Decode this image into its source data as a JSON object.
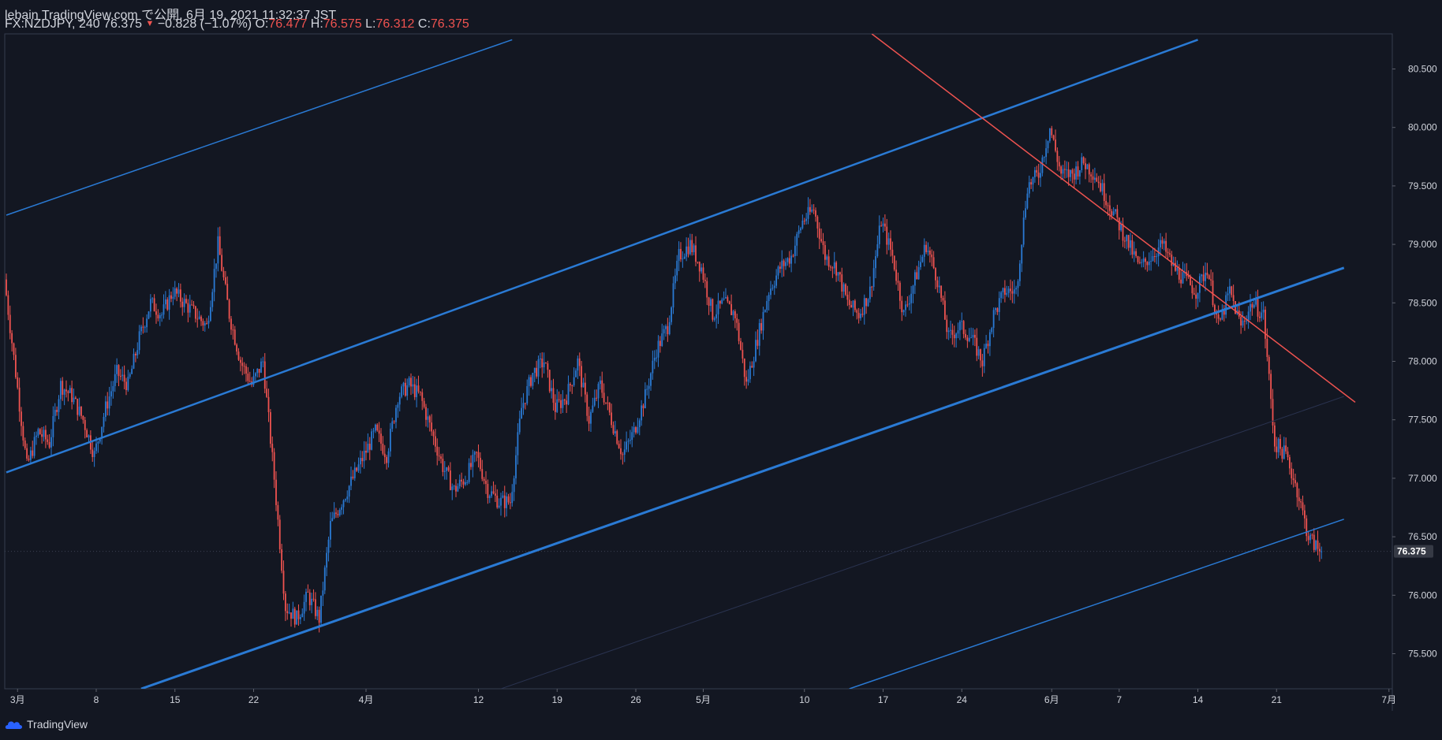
{
  "header": {
    "line1": "lebain TradingView.com で公開, 6月 19, 2021 11:32:37 JST",
    "symbol": "FX:NZDJPY, 240",
    "last": "76.375",
    "change": "−0.828 (−1.07%)",
    "o_label": "O:",
    "o_value": "76.477",
    "h_label": "H:",
    "h_value": "76.575",
    "l_label": "L:",
    "l_value": "76.312",
    "c_label": "C:",
    "c_value": "76.375"
  },
  "footer": {
    "brand": "TradingView"
  },
  "colors": {
    "background": "#131722",
    "up": "#2a7ad4",
    "down": "#ef5350",
    "channel": "#2a7ad4",
    "trendline": "#ef5350",
    "axis_text": "#d1d4dc"
  },
  "chart_data": {
    "type": "candlestick",
    "symbol": "FX:NZDJPY",
    "interval": "240",
    "ylim": [
      75.2,
      80.8
    ],
    "y_ticks": [
      "80.500",
      "80.000",
      "79.500",
      "79.000",
      "78.500",
      "78.000",
      "77.500",
      "77.000",
      "76.500",
      "76.000",
      "75.500"
    ],
    "y_tick_values": [
      80.5,
      80.0,
      79.5,
      79.0,
      78.5,
      78.0,
      77.5,
      77.0,
      76.5,
      76.0,
      75.5
    ],
    "last_price_label": "76.375",
    "last_price": 76.375,
    "xlim": [
      0,
      120
    ],
    "x_ticks": [
      {
        "label": "3月",
        "d": 1
      },
      {
        "label": "8",
        "d": 8
      },
      {
        "label": "15",
        "d": 15
      },
      {
        "label": "22",
        "d": 22
      },
      {
        "label": "4月",
        "d": 32
      },
      {
        "label": "12",
        "d": 42
      },
      {
        "label": "19",
        "d": 49
      },
      {
        "label": "26",
        "d": 56
      },
      {
        "label": "5月",
        "d": 62
      },
      {
        "label": "10",
        "d": 71
      },
      {
        "label": "17",
        "d": 78
      },
      {
        "label": "24",
        "d": 85
      },
      {
        "label": "6月",
        "d": 93
      },
      {
        "label": "7",
        "d": 99
      },
      {
        "label": "14",
        "d": 106
      },
      {
        "label": "21",
        "d": 113
      },
      {
        "label": "7月",
        "d": 123
      }
    ],
    "price_path": [
      [
        0,
        78.7
      ],
      [
        1,
        77.9
      ],
      [
        2,
        77.1
      ],
      [
        3,
        77.4
      ],
      [
        4,
        77.3
      ],
      [
        5,
        77.8
      ],
      [
        6,
        77.7
      ],
      [
        7,
        77.5
      ],
      [
        8,
        77.2
      ],
      [
        9,
        77.6
      ],
      [
        10,
        77.9
      ],
      [
        11,
        77.8
      ],
      [
        12,
        78.2
      ],
      [
        13,
        78.5
      ],
      [
        14,
        78.4
      ],
      [
        15,
        78.6
      ],
      [
        16,
        78.5
      ],
      [
        17,
        78.4
      ],
      [
        18,
        78.3
      ],
      [
        19,
        79.0
      ],
      [
        20,
        78.4
      ],
      [
        21,
        78.0
      ],
      [
        22,
        77.8
      ],
      [
        23,
        78.0
      ],
      [
        24,
        77.0
      ],
      [
        25,
        75.9
      ],
      [
        26,
        75.8
      ],
      [
        27,
        76.0
      ],
      [
        28,
        75.8
      ],
      [
        29,
        76.6
      ],
      [
        30,
        76.8
      ],
      [
        31,
        77.0
      ],
      [
        32,
        77.2
      ],
      [
        33,
        77.4
      ],
      [
        34,
        77.2
      ],
      [
        35,
        77.7
      ],
      [
        36,
        77.8
      ],
      [
        37,
        77.7
      ],
      [
        38,
        77.4
      ],
      [
        39,
        77.1
      ],
      [
        40,
        76.9
      ],
      [
        41,
        77.0
      ],
      [
        42,
        77.2
      ],
      [
        43,
        76.9
      ],
      [
        44,
        76.8
      ],
      [
        45,
        76.8
      ],
      [
        46,
        77.6
      ],
      [
        47,
        77.9
      ],
      [
        48,
        78.0
      ],
      [
        49,
        77.6
      ],
      [
        50,
        77.7
      ],
      [
        51,
        78.0
      ],
      [
        52,
        77.5
      ],
      [
        53,
        77.8
      ],
      [
        54,
        77.5
      ],
      [
        55,
        77.2
      ],
      [
        56,
        77.4
      ],
      [
        57,
        77.7
      ],
      [
        58,
        78.1
      ],
      [
        59,
        78.3
      ],
      [
        60,
        78.9
      ],
      [
        61,
        79.0
      ],
      [
        62,
        78.8
      ],
      [
        63,
        78.4
      ],
      [
        64,
        78.5
      ],
      [
        65,
        78.4
      ],
      [
        66,
        77.8
      ],
      [
        67,
        78.2
      ],
      [
        68,
        78.6
      ],
      [
        69,
        78.8
      ],
      [
        70,
        78.9
      ],
      [
        71,
        79.2
      ],
      [
        72,
        79.3
      ],
      [
        73,
        78.9
      ],
      [
        74,
        78.8
      ],
      [
        75,
        78.5
      ],
      [
        76,
        78.4
      ],
      [
        77,
        78.6
      ],
      [
        78,
        79.2
      ],
      [
        79,
        78.9
      ],
      [
        80,
        78.4
      ],
      [
        81,
        78.7
      ],
      [
        82,
        79.0
      ],
      [
        83,
        78.7
      ],
      [
        84,
        78.2
      ],
      [
        85,
        78.3
      ],
      [
        86,
        78.2
      ],
      [
        87,
        78.0
      ],
      [
        88,
        78.4
      ],
      [
        89,
        78.6
      ],
      [
        90,
        78.6
      ],
      [
        91,
        79.5
      ],
      [
        92,
        79.6
      ],
      [
        93,
        80.0
      ],
      [
        94,
        79.6
      ],
      [
        95,
        79.6
      ],
      [
        96,
        79.7
      ],
      [
        97,
        79.6
      ],
      [
        98,
        79.4
      ],
      [
        99,
        79.2
      ],
      [
        100,
        79.0
      ],
      [
        101,
        78.8
      ],
      [
        102,
        78.9
      ],
      [
        103,
        79.0
      ],
      [
        104,
        78.8
      ],
      [
        105,
        78.7
      ],
      [
        106,
        78.6
      ],
      [
        107,
        78.8
      ],
      [
        108,
        78.3
      ],
      [
        109,
        78.6
      ],
      [
        110,
        78.3
      ],
      [
        111,
        78.5
      ],
      [
        112,
        78.4
      ],
      [
        113,
        77.3
      ],
      [
        114,
        77.2
      ],
      [
        115,
        76.9
      ],
      [
        116,
        76.5
      ],
      [
        117,
        76.375
      ]
    ],
    "lines": [
      {
        "name": "channel-upper-outer",
        "color": "#2a7ad4",
        "p1": [
          0,
          79.25
        ],
        "p2": [
          45,
          80.75
        ],
        "width": 1.5
      },
      {
        "name": "channel-upper",
        "color": "#2a7ad4",
        "p1": [
          0,
          77.05
        ],
        "p2": [
          106,
          80.75
        ],
        "width": 2.5
      },
      {
        "name": "channel-middle",
        "color": "#2a7ad4",
        "p1": [
          12,
          75.2
        ],
        "p2": [
          119,
          78.8
        ],
        "width": 3
      },
      {
        "name": "channel-lower",
        "color": "#2a7ad4",
        "p1": [
          75,
          75.2
        ],
        "p2": [
          119,
          76.65
        ],
        "width": 1.5
      },
      {
        "name": "channel-median-faint",
        "color": "#2a3350",
        "p1": [
          44,
          75.2
        ],
        "p2": [
          119,
          77.7
        ],
        "width": 1
      },
      {
        "name": "trendline-down",
        "color": "#ef5350",
        "p1": [
          77,
          80.8
        ],
        "p2": [
          120,
          77.65
        ],
        "width": 1.5
      }
    ]
  }
}
